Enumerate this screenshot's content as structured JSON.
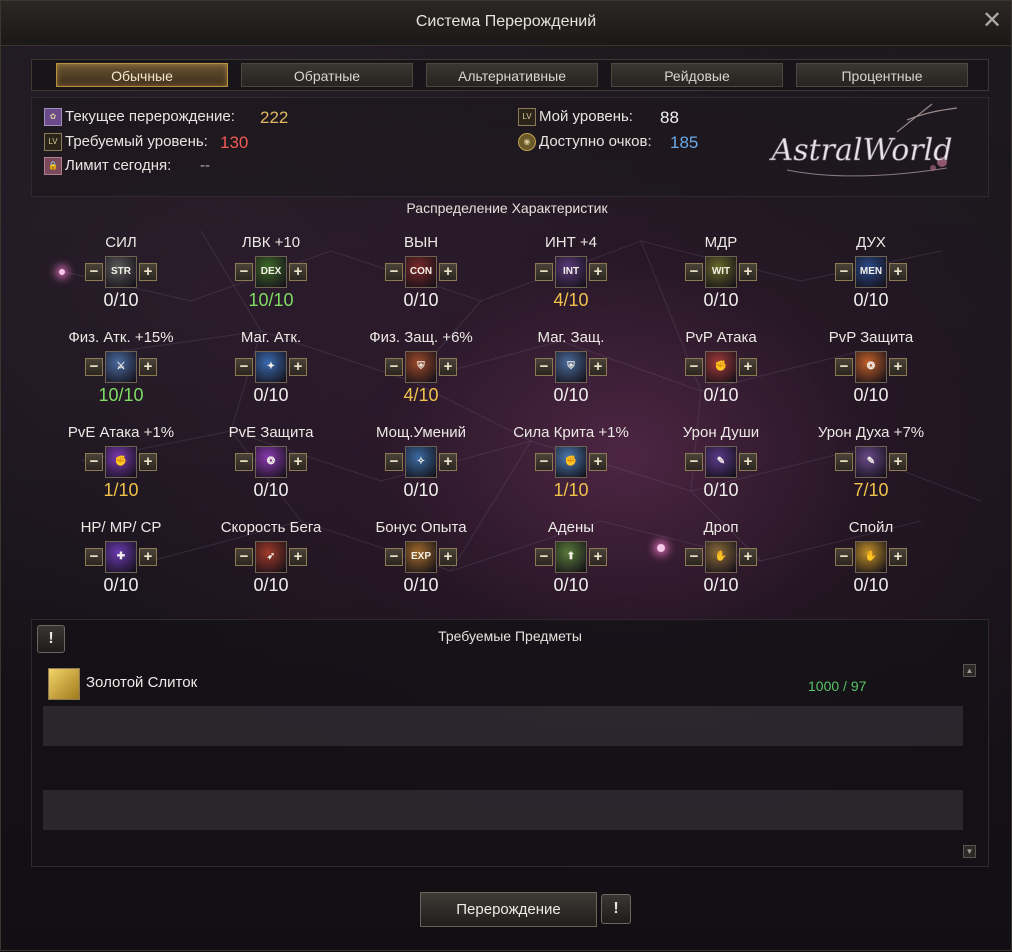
{
  "window": {
    "title": "Система Перерождений"
  },
  "tabs": [
    {
      "label": "Обычные",
      "active": true
    },
    {
      "label": "Обратные"
    },
    {
      "label": "Альтернативные"
    },
    {
      "label": "Рейдовые"
    },
    {
      "label": "Процентные"
    }
  ],
  "info": {
    "current_rebirth_label": "Текущее перерождение:",
    "current_rebirth_value": "222",
    "required_level_label": "Требуемый уровень:",
    "required_level_value": "130",
    "limit_today_label": "Лимит сегодня:",
    "limit_today_value": "--",
    "my_level_label": "Мой уровень:",
    "my_level_value": "88",
    "points_label": "Доступно очков:",
    "points_value": "185",
    "level_icon_text": "LV",
    "logo_text": "AstralWorld"
  },
  "stats_title": "Распределение Характеристик",
  "stats": [
    {
      "label": "СИЛ",
      "icon_text": "STR",
      "icon_color": "#5a5a5a",
      "value": "0/10",
      "tone": "w"
    },
    {
      "label": "ЛВК +10",
      "icon_text": "DEX",
      "icon_color": "#3f6a2a",
      "value": "10/10",
      "tone": "g"
    },
    {
      "label": "ВЫН",
      "icon_text": "CON",
      "icon_color": "#7a2a2a",
      "value": "0/10",
      "tone": "w"
    },
    {
      "label": "ИНТ +4",
      "icon_text": "INT",
      "icon_color": "#5a3a7a",
      "value": "4/10",
      "tone": "y"
    },
    {
      "label": "МДР",
      "icon_text": "WIT",
      "icon_color": "#6a6a2a",
      "value": "0/10",
      "tone": "w"
    },
    {
      "label": "ДУХ",
      "icon_text": "MEN",
      "icon_color": "#2a4a8a",
      "value": "0/10",
      "tone": "w"
    },
    {
      "label": "Физ. Атк. +15%",
      "icon_text": "⚔",
      "icon_color": "#4a6aa0",
      "value": "10/10",
      "tone": "g"
    },
    {
      "label": "Маг. Атк.",
      "icon_text": "✦",
      "icon_color": "#3a6ab0",
      "value": "0/10",
      "tone": "w"
    },
    {
      "label": "Физ. Защ. +6%",
      "icon_text": "⛨",
      "icon_color": "#9a4a2a",
      "value": "4/10",
      "tone": "y"
    },
    {
      "label": "Маг. Защ.",
      "icon_text": "⛨",
      "icon_color": "#4a6a9a",
      "value": "0/10",
      "tone": "w"
    },
    {
      "label": "PvP Атака",
      "icon_text": "✊",
      "icon_color": "#a03a3a",
      "value": "0/10",
      "tone": "w"
    },
    {
      "label": "PvP Защита",
      "icon_text": "❂",
      "icon_color": "#c0602a",
      "value": "0/10",
      "tone": "w"
    },
    {
      "label": "PvE Атака +1%",
      "icon_text": "✊",
      "icon_color": "#7a3ab0",
      "value": "1/10",
      "tone": "y"
    },
    {
      "label": "PvE Защита",
      "icon_text": "❂",
      "icon_color": "#8a3ab0",
      "value": "0/10",
      "tone": "w"
    },
    {
      "label": "Мощ.Умений",
      "icon_text": "✧",
      "icon_color": "#3a6aa0",
      "value": "0/10",
      "tone": "w"
    },
    {
      "label": "Сила Крита +1%",
      "icon_text": "✊",
      "icon_color": "#4a7ab0",
      "value": "1/10",
      "tone": "y"
    },
    {
      "label": "Урон Души",
      "icon_text": "✎",
      "icon_color": "#5a3a8a",
      "value": "0/10",
      "tone": "w"
    },
    {
      "label": "Урон Духа +7%",
      "icon_text": "✎",
      "icon_color": "#6a4a8a",
      "value": "7/10",
      "tone": "y"
    },
    {
      "label": "HP/ MP/ CP",
      "icon_text": "✚",
      "icon_color": "#6a3ab0",
      "value": "0/10",
      "tone": "w"
    },
    {
      "label": "Скорость Бега",
      "icon_text": "➶",
      "icon_color": "#a03a2a",
      "value": "0/10",
      "tone": "w"
    },
    {
      "label": "Бонус Опыта",
      "icon_text": "EXP",
      "icon_color": "#a06a2a",
      "value": "0/10",
      "tone": "w"
    },
    {
      "label": "Адены",
      "icon_text": "⬆",
      "icon_color": "#5a7a3a",
      "value": "0/10",
      "tone": "w"
    },
    {
      "label": "Дроп",
      "icon_text": "✋",
      "icon_color": "#8a6a3a",
      "value": "0/10",
      "tone": "w"
    },
    {
      "label": "Спойл",
      "icon_text": "✋",
      "icon_color": "#c0902a",
      "value": "0/10",
      "tone": "w"
    }
  ],
  "items": {
    "title": "Требуемые Предметы",
    "warn_icon_text": "!",
    "list": [
      {
        "name": "Золотой Слиток",
        "count": "1000 / 97",
        "icon_color": "#c8a030"
      }
    ],
    "scroll_up": "▲",
    "scroll_down": "▼"
  },
  "actions": {
    "rebirth_label": "Перерождение",
    "info_icon_text": "!"
  }
}
